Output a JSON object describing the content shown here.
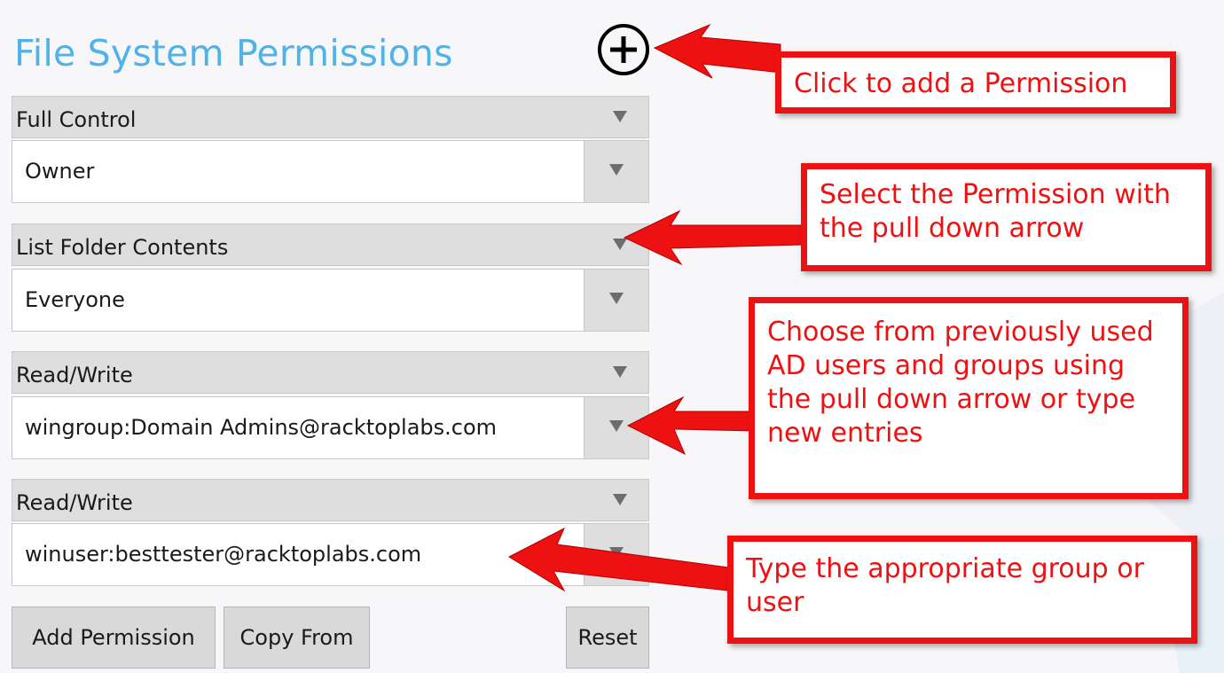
{
  "page": {
    "title": "File System Permissions"
  },
  "permissions": [
    {
      "permission": "Full Control",
      "principal": "Owner"
    },
    {
      "permission": "List Folder Contents",
      "principal": "Everyone"
    },
    {
      "permission": "Read/Write",
      "principal": "wingroup:Domain Admins@racktoplabs.com"
    },
    {
      "permission": "Read/Write",
      "principal": "winuser:besttester@racktoplabs.com"
    }
  ],
  "buttons": {
    "add_permission": "Add Permission",
    "copy_from": "Copy From",
    "reset": "Reset"
  },
  "callouts": {
    "add": "Click to add a Permission",
    "select": "Select the Permission with the pull down arrow",
    "choose": "Choose from previously used AD users and groups using the pull down arrow or type new entries",
    "type": "Type the appropriate group or user"
  },
  "icons": {
    "add": "plus-circle-icon",
    "dropdown": "triangle-down-icon"
  },
  "colors": {
    "title": "#4fb3ea",
    "callout": "#ee1111",
    "row": "#dedede"
  }
}
